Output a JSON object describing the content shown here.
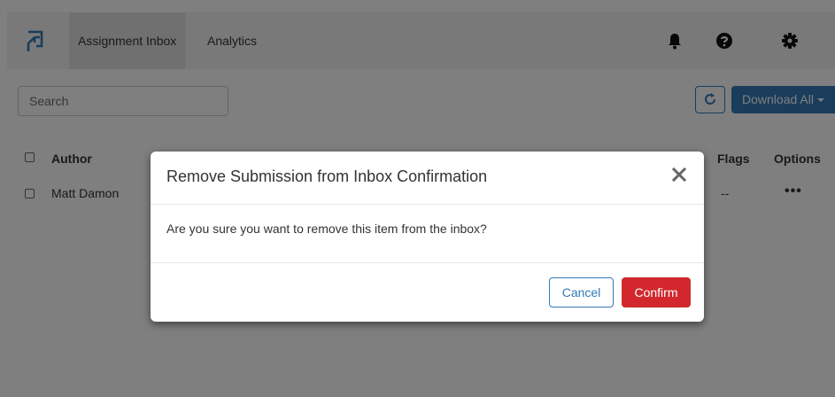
{
  "navbar": {
    "tabs": [
      {
        "label": "Assignment Inbox",
        "active": true
      },
      {
        "label": "Analytics",
        "active": false
      }
    ],
    "icons": [
      "bell-icon",
      "help-icon",
      "gear-icon"
    ]
  },
  "toolbar": {
    "search_placeholder": "Search",
    "refresh_icon": "refresh-icon",
    "download_label": "Download All"
  },
  "table": {
    "columns": [
      "Author",
      "Flags",
      "Options"
    ],
    "rows": [
      {
        "author": "Matt Damon",
        "flags": "--",
        "options": "•••"
      }
    ]
  },
  "modal": {
    "title": "Remove Submission from Inbox Confirmation",
    "body": "Are you sure you want to remove this item from the inbox?",
    "cancel_label": "Cancel",
    "confirm_label": "Confirm"
  },
  "colors": {
    "primary": "#337ab7",
    "danger": "#d2282d",
    "navbar_bg": "#f2f2f2"
  }
}
